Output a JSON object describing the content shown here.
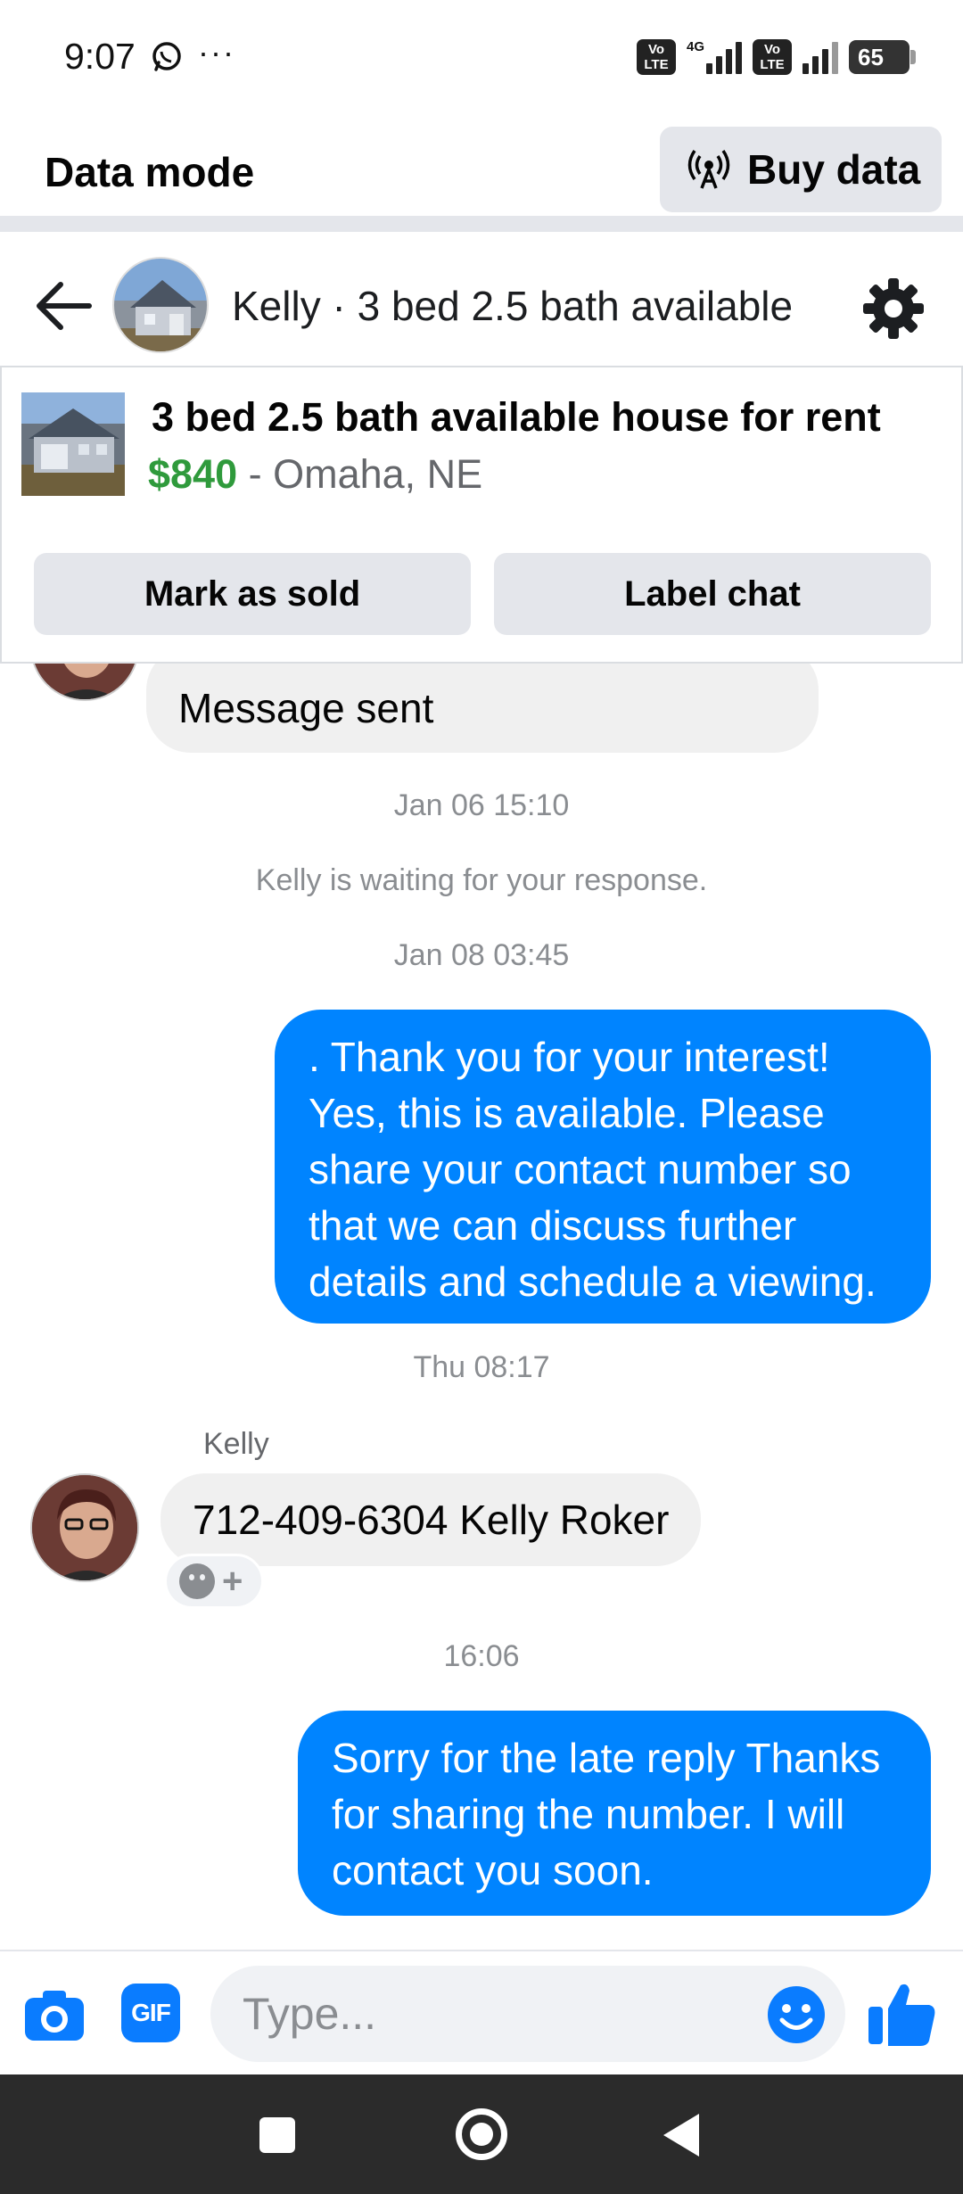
{
  "status_bar": {
    "time": "9:07",
    "more": "···",
    "volte_1": "Vo LTE",
    "network": "4G",
    "volte_2": "Vo LTE",
    "battery": "65"
  },
  "data_mode": {
    "title": "Data mode",
    "buy_label": "Buy data"
  },
  "chat_header": {
    "title": "Kelly · 3 bed 2.5 bath available",
    "icons": [
      "back-arrow-icon",
      "settings-icon"
    ]
  },
  "listing": {
    "title": "3 bed 2.5 bath available house for rent",
    "price": "$840",
    "location": " - Omaha, NE",
    "mark_sold": "Mark as sold",
    "label_chat": "Label chat",
    "price_color": "#2f9a3c"
  },
  "messages": {
    "msg1": "Message sent",
    "ts1": "Jan 06 15:10",
    "waiting": "Kelly is waiting for your response.",
    "ts2": "Jan 08 03:45",
    "out1": ". Thank you for your interest! Yes, this is available. Please share your contact number so that we can discuss further details and schedule a viewing.",
    "ts3": "Thu 08:17",
    "sender": "Kelly",
    "in2": "712-409-6304 Kelly Roker",
    "react_plus": "+",
    "ts4": "16:06",
    "out2": "Sorry for the late reply Thanks for sharing the number. I will contact you soon."
  },
  "composer": {
    "placeholder": "Type...",
    "gif_label": "GIF",
    "icons": [
      "camera-icon",
      "emoji-icon",
      "thumbs-up-icon"
    ],
    "accent": "#0084ff"
  }
}
